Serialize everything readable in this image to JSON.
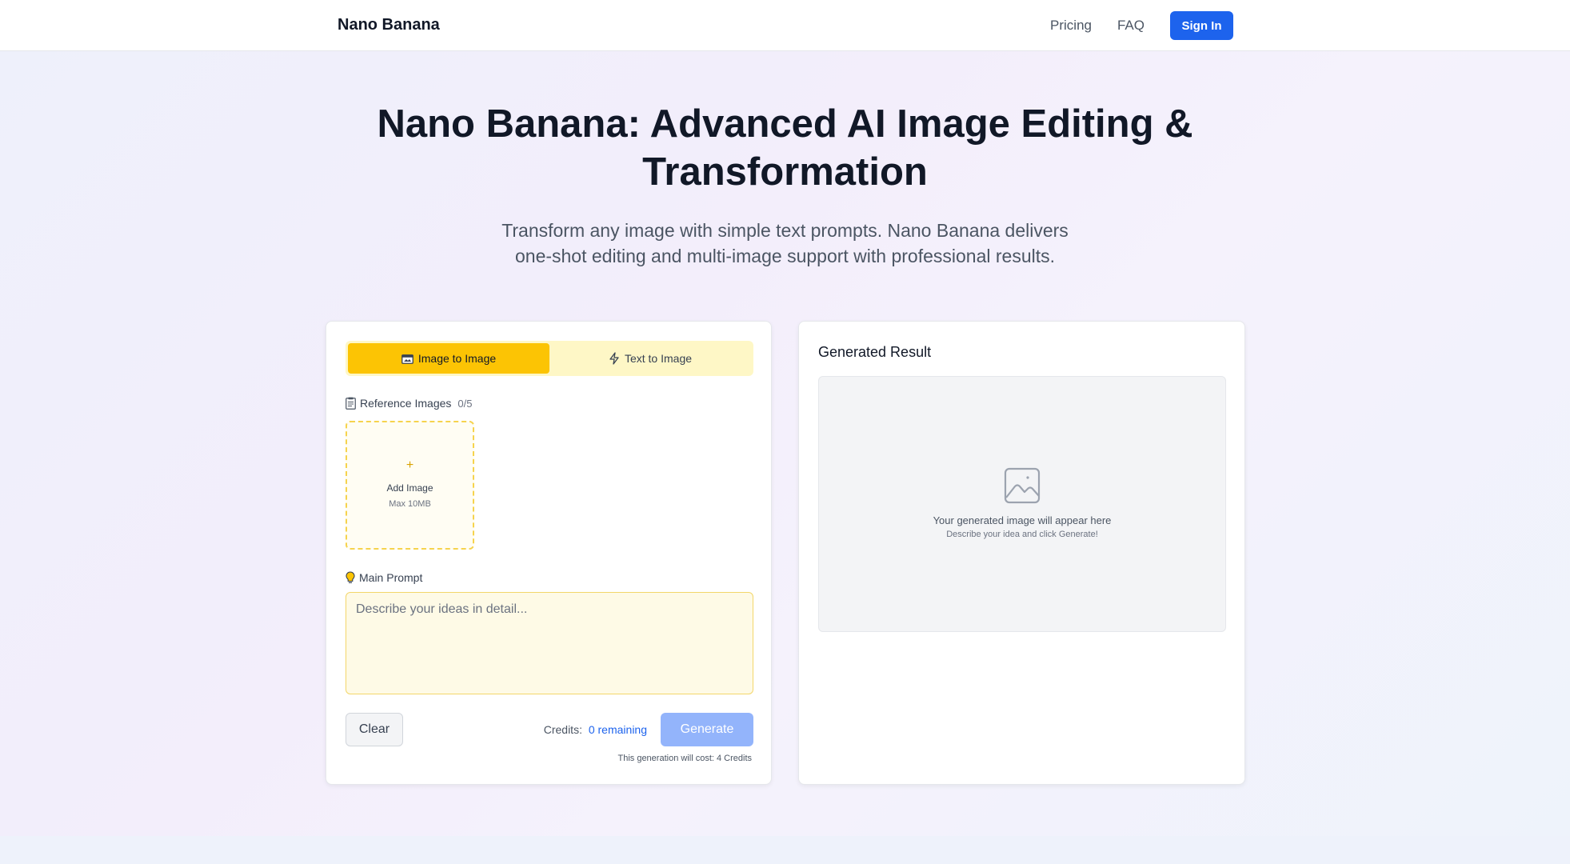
{
  "nav": {
    "brand": "Nano Banana",
    "links": [
      "Pricing",
      "FAQ"
    ],
    "signin": "Sign In"
  },
  "hero": {
    "title_line1": "Nano Banana: Advanced AI Image Editing &",
    "title_line2": "Transformation",
    "subtitle_line1": "Transform any image with simple text prompts. Nano Banana delivers",
    "subtitle_line2": "one-shot editing and multi-image support with professional results."
  },
  "editor": {
    "tabs": [
      {
        "label": "Image to Image",
        "icon": "image-icon",
        "active": true
      },
      {
        "label": "Text to Image",
        "icon": "lightning-icon",
        "active": false
      }
    ],
    "reference": {
      "label": "Reference Images",
      "count": "0/5",
      "add_label": "Add Image",
      "add_plus": "+",
      "max_label": "Max 10MB"
    },
    "prompt": {
      "label": "Main Prompt",
      "placeholder": "Describe your ideas in detail..."
    },
    "clear": "Clear",
    "credits_label": "Credits:",
    "credits_value": "0 remaining",
    "generate": "Generate",
    "cost_note": "This generation will cost: 4 Credits"
  },
  "result": {
    "title": "Generated Result",
    "placeholder_main": "Your generated image will appear here",
    "placeholder_hint": "Describe your idea and click Generate!"
  },
  "colors": {
    "accent": "#1d63ed",
    "tab_active": "#fcc404",
    "tab_bg": "#fef7c6",
    "generate_disabled": "#93b4fb"
  }
}
